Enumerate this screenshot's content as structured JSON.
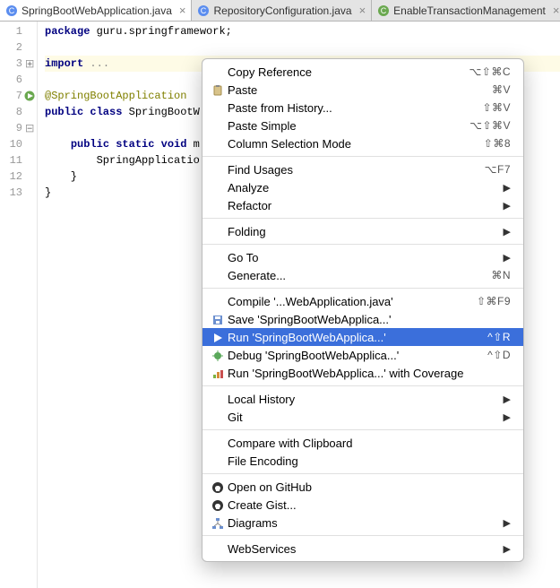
{
  "tabs": [
    {
      "label": "SpringBootWebApplication.java",
      "iconColor": "#5b8def",
      "active": true
    },
    {
      "label": "RepositoryConfiguration.java",
      "iconColor": "#5b8def",
      "active": false
    },
    {
      "label": "EnableTransactionManagement",
      "iconColor": "#6aa84f",
      "active": false
    }
  ],
  "code": {
    "lines": [
      {
        "n": "1",
        "html": "<span class='k'>package</span> guru.springframework;"
      },
      {
        "n": "2",
        "html": ""
      },
      {
        "n": "3",
        "html": "<span class='k'>import</span> <span class='dim'>...</span>",
        "band": true,
        "fold": "+"
      },
      {
        "n": "",
        "html": ""
      },
      {
        "n": "6",
        "html": "<span class='ann'>@SpringBootApplication</span>"
      },
      {
        "n": "7",
        "html": "<span class='k'>public class</span> SpringBootW",
        "run": true
      },
      {
        "n": "8",
        "html": ""
      },
      {
        "n": "9",
        "html": "    <span class='k'>public static void</span> m",
        "fold": "-"
      },
      {
        "n": "10",
        "html": "        SpringApplicatio"
      },
      {
        "n": "11",
        "html": "    }"
      },
      {
        "n": "12",
        "html": "}"
      },
      {
        "n": "13",
        "html": ""
      }
    ]
  },
  "menu": [
    {
      "type": "item",
      "label": "Copy Reference",
      "shortcut": "⌥⇧⌘C"
    },
    {
      "type": "item",
      "label": "Paste",
      "shortcut": "⌘V",
      "icon": "paste"
    },
    {
      "type": "item",
      "label": "Paste from History...",
      "shortcut": "⇧⌘V"
    },
    {
      "type": "item",
      "label": "Paste Simple",
      "shortcut": "⌥⇧⌘V"
    },
    {
      "type": "item",
      "label": "Column Selection Mode",
      "shortcut": "⇧⌘8"
    },
    {
      "type": "sep"
    },
    {
      "type": "item",
      "label": "Find Usages",
      "shortcut": "⌥F7"
    },
    {
      "type": "item",
      "label": "Analyze",
      "submenu": true
    },
    {
      "type": "item",
      "label": "Refactor",
      "submenu": true
    },
    {
      "type": "sep"
    },
    {
      "type": "item",
      "label": "Folding",
      "submenu": true
    },
    {
      "type": "sep"
    },
    {
      "type": "item",
      "label": "Go To",
      "submenu": true
    },
    {
      "type": "item",
      "label": "Generate...",
      "shortcut": "⌘N"
    },
    {
      "type": "sep"
    },
    {
      "type": "item",
      "label": "Compile '...WebApplication.java'",
      "shortcut": "⇧⌘F9"
    },
    {
      "type": "item",
      "label": "Save 'SpringBootWebApplica...'",
      "icon": "save"
    },
    {
      "type": "item",
      "label": "Run 'SpringBootWebApplica...'",
      "shortcut": "^⇧R",
      "icon": "run",
      "selected": true
    },
    {
      "type": "item",
      "label": "Debug 'SpringBootWebApplica...'",
      "shortcut": "^⇧D",
      "icon": "debug"
    },
    {
      "type": "item",
      "label": "Run 'SpringBootWebApplica...' with Coverage",
      "icon": "coverage"
    },
    {
      "type": "sep"
    },
    {
      "type": "item",
      "label": "Local History",
      "submenu": true
    },
    {
      "type": "item",
      "label": "Git",
      "submenu": true
    },
    {
      "type": "sep"
    },
    {
      "type": "item",
      "label": "Compare with Clipboard"
    },
    {
      "type": "item",
      "label": "File Encoding"
    },
    {
      "type": "sep"
    },
    {
      "type": "item",
      "label": "Open on GitHub",
      "icon": "github"
    },
    {
      "type": "item",
      "label": "Create Gist...",
      "icon": "github"
    },
    {
      "type": "item",
      "label": "Diagrams",
      "icon": "diagram",
      "submenu": true
    },
    {
      "type": "sep"
    },
    {
      "type": "item",
      "label": "WebServices",
      "submenu": true
    }
  ]
}
